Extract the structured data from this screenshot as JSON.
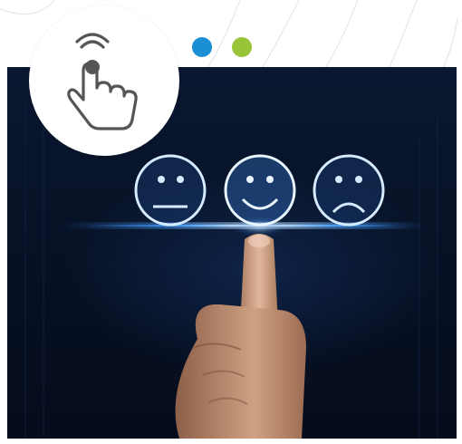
{
  "colors": {
    "dot_blue": "#1b8fd4",
    "dot_green": "#98c43a",
    "face_glow": "#8fc6ff",
    "icon_gray": "#555555"
  },
  "icons": {
    "badge": "touch-gesture-icon",
    "faces": [
      "neutral-face-icon",
      "happy-face-icon",
      "sad-face-icon"
    ]
  }
}
